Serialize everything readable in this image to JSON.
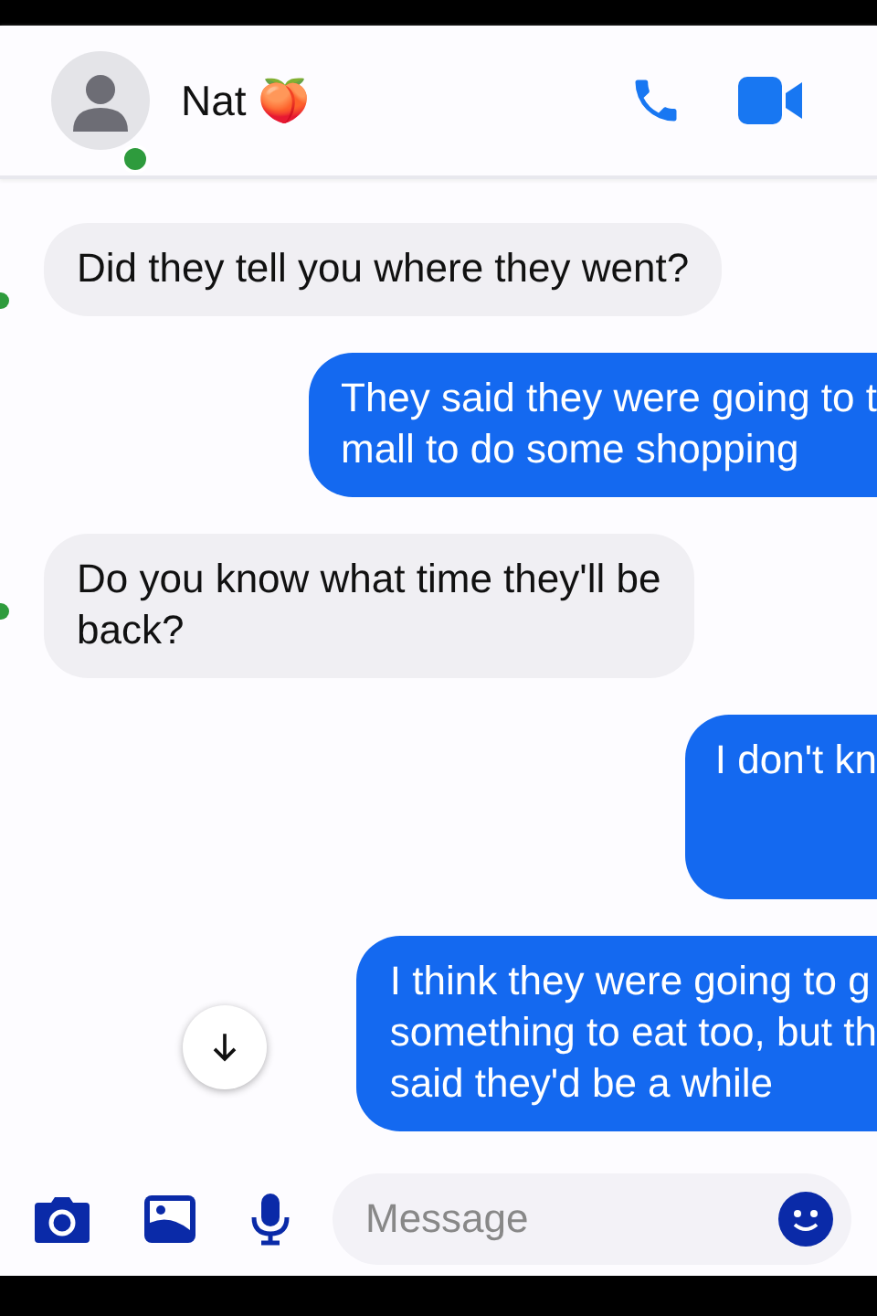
{
  "header": {
    "contact_name": "Nat 🍑",
    "online": true
  },
  "messages": [
    {
      "kind": "received",
      "lines": [
        "Did they tell you where they went?"
      ]
    },
    {
      "kind": "sent",
      "lines": [
        "They said they were going to t",
        "mall to do some shopping"
      ]
    },
    {
      "kind": "received",
      "lines": [
        "Do you know what time they'll be",
        "back?"
      ]
    },
    {
      "kind": "sent",
      "lines": [
        "I don't kn"
      ],
      "tall": true
    },
    {
      "kind": "sent",
      "lines": [
        "I think they were going to g",
        "something to eat too, but th",
        "said they'd be a while"
      ]
    }
  ],
  "composer": {
    "placeholder": "Message"
  }
}
